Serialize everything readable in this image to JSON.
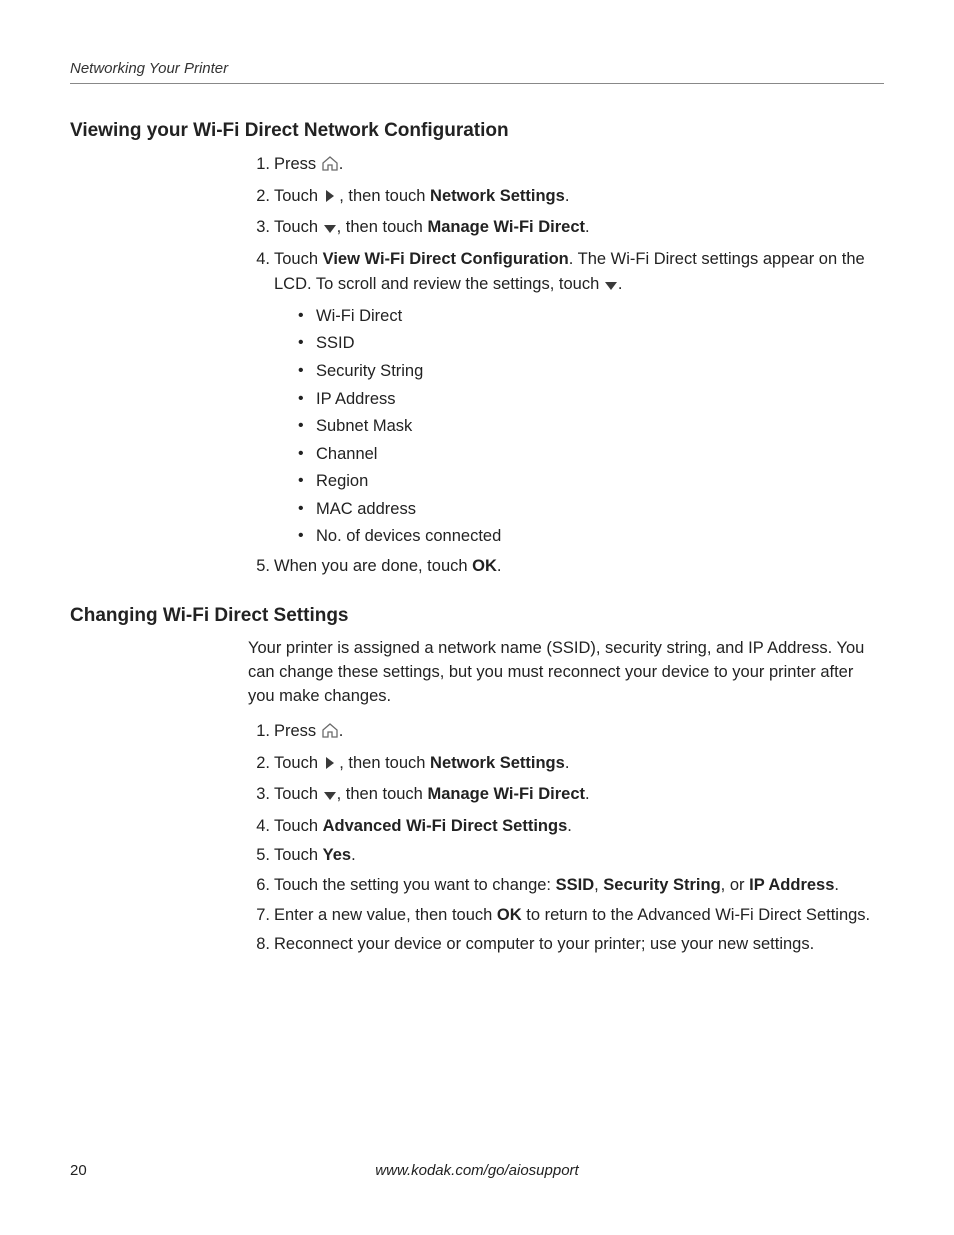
{
  "header": {
    "running_title": "Networking Your Printer"
  },
  "section1": {
    "heading": "Viewing your Wi-Fi Direct Network Configuration",
    "steps": {
      "s1_a": "Press ",
      "s1_b": ".",
      "s2_a": "Touch ",
      "s2_b": " , then touch ",
      "s2_bold": "Network Settings",
      "s2_c": ".",
      "s3_a": "Touch ",
      "s3_b": ", then touch ",
      "s3_bold": "Manage Wi-Fi Direct",
      "s3_c": ".",
      "s4_a": "Touch ",
      "s4_bold": "View Wi-Fi Direct Configuration",
      "s4_b": ". The Wi-Fi Direct settings appear on the LCD. To scroll and review the settings, touch ",
      "s4_c": ".",
      "bullets": [
        "Wi-Fi Direct",
        "SSID",
        "Security String",
        "IP Address",
        "Subnet Mask",
        "Channel",
        "Region",
        "MAC address",
        "No. of devices connected"
      ],
      "s5_a": "When you are done, touch ",
      "s5_bold": "OK",
      "s5_b": "."
    }
  },
  "section2": {
    "heading": "Changing Wi-Fi Direct Settings",
    "intro": "Your printer is assigned a network name (SSID), security string, and IP Address. You can change these settings, but you must reconnect your device to your printer after you make changes.",
    "steps": {
      "s1_a": "Press ",
      "s1_b": ".",
      "s2_a": "Touch ",
      "s2_b": " , then touch ",
      "s2_bold": "Network Settings",
      "s2_c": ".",
      "s3_a": "Touch ",
      "s3_b": ", then touch ",
      "s3_bold": "Manage Wi-Fi Direct",
      "s3_c": ".",
      "s4_a": "Touch ",
      "s4_bold": "Advanced Wi-Fi Direct Settings",
      "s4_b": ".",
      "s5_a": "Touch ",
      "s5_bold": "Yes",
      "s5_b": ".",
      "s6_a": "Touch the setting you want to change: ",
      "s6_b1": "SSID",
      "s6_sep1": ", ",
      "s6_b2": "Security String",
      "s6_sep2": ", or ",
      "s6_b3": "IP Address",
      "s6_c": ".",
      "s7_a": "Enter a new value, then touch ",
      "s7_bold": "OK",
      "s7_b": " to return to the Advanced Wi-Fi Direct Settings.",
      "s8": "Reconnect your device or computer to your printer; use your new settings."
    }
  },
  "footer": {
    "page": "20",
    "url": "www.kodak.com/go/aiosupport"
  }
}
